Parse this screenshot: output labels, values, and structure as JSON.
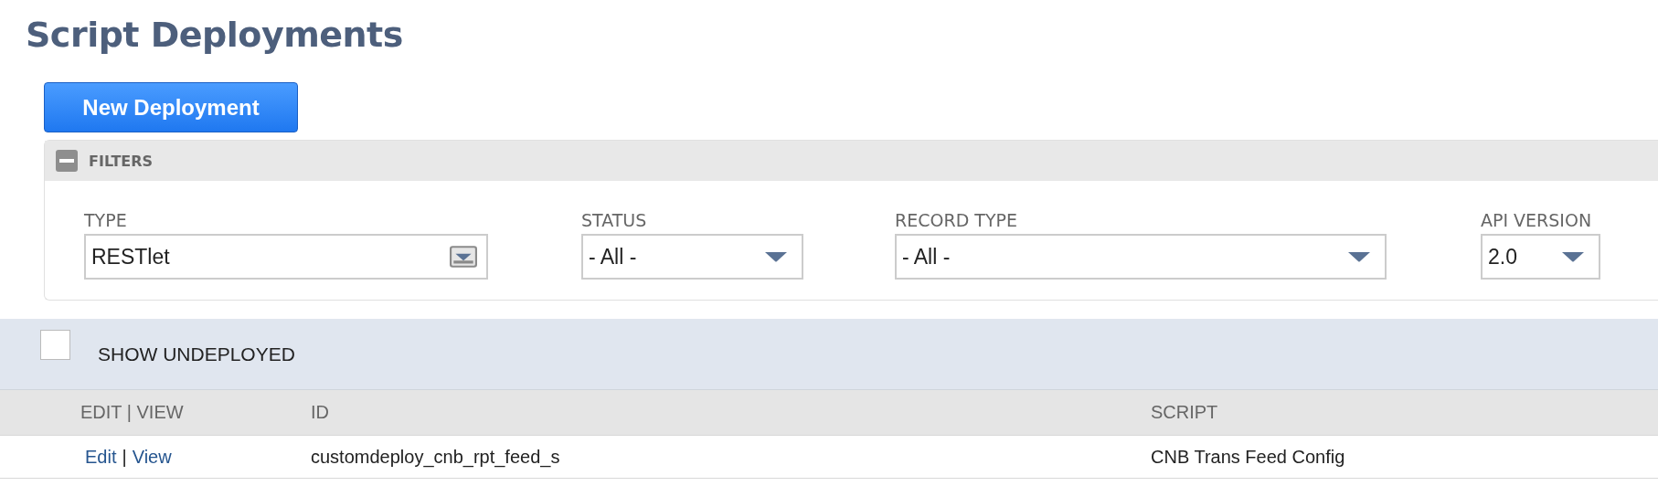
{
  "page": {
    "title": "Script Deployments"
  },
  "new_button": {
    "label": "New Deployment"
  },
  "filters": {
    "title": "FILTERS",
    "expanded": true,
    "fields": [
      {
        "label": "TYPE",
        "value": "RESTlet",
        "kind": "popup"
      },
      {
        "label": "STATUS",
        "value": "- All -",
        "kind": "select"
      },
      {
        "label": "RECORD TYPE",
        "value": "- All -",
        "kind": "select"
      },
      {
        "label": "API VERSION",
        "value": "2.0",
        "kind": "select"
      }
    ]
  },
  "show_undeployed": {
    "label": "SHOW UNDEPLOYED",
    "checked": false
  },
  "table": {
    "columns": [
      "EDIT | VIEW",
      "ID",
      "SCRIPT"
    ],
    "rows": [
      {
        "actions": [
          "Edit",
          "View"
        ],
        "separator": "|",
        "id": "customdeploy_cnb_rpt_feed_s",
        "script": "CNB Trans Feed Config"
      }
    ]
  }
}
